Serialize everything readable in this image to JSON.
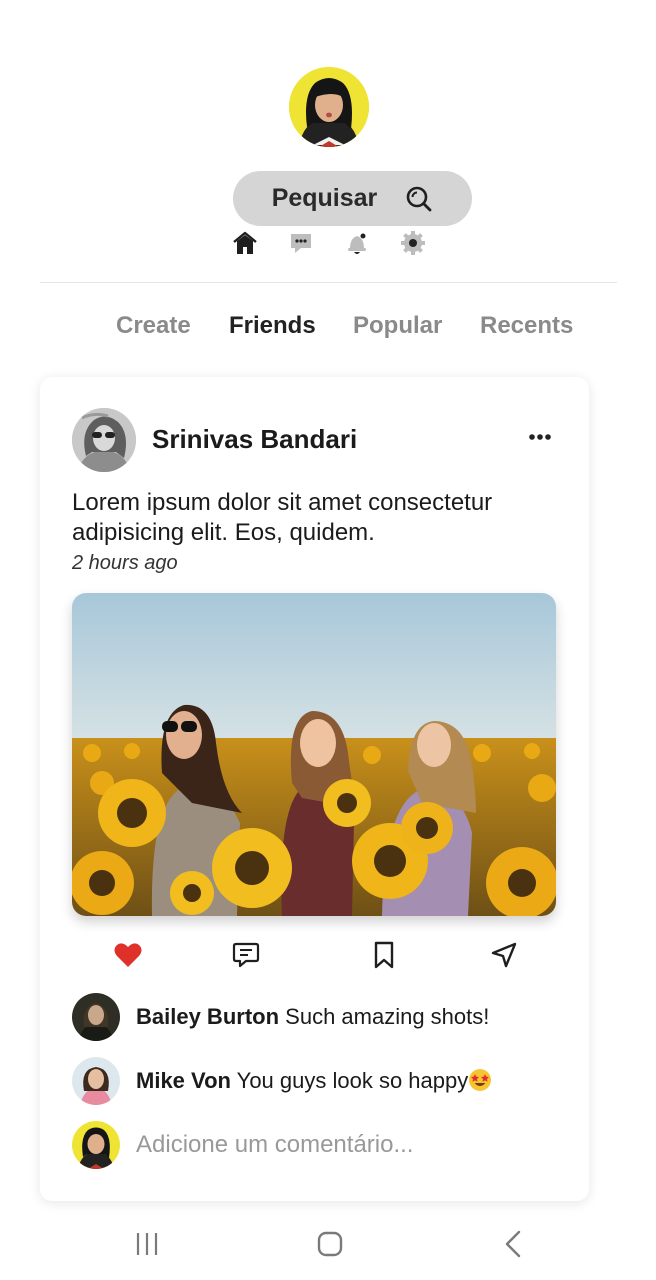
{
  "header": {
    "search_label": "Pequisar",
    "icons": [
      "home-icon",
      "chat-icon",
      "bell-icon",
      "settings-icon"
    ]
  },
  "tabs": [
    {
      "label": "Create",
      "active": false
    },
    {
      "label": "Friends",
      "active": true
    },
    {
      "label": "Popular",
      "active": false
    },
    {
      "label": "Recents",
      "active": false
    }
  ],
  "post": {
    "author": "Srinivas Bandari",
    "text": "Lorem ipsum dolor sit amet consectetur adipisicing elit. Eos, quidem.",
    "time": "2 hours ago",
    "liked": true,
    "actions": [
      "heart-icon",
      "comment-icon",
      "bookmark-icon",
      "share-icon"
    ],
    "comments": [
      {
        "author": "Bailey Burton",
        "text": "Such amazing shots!",
        "emoji": ""
      },
      {
        "author": "Mike Von",
        "text": "You guys look so happy",
        "emoji": "star-struck-emoji"
      }
    ],
    "comment_placeholder": "Adicione um comentário..."
  },
  "colors": {
    "like": "#e0302a",
    "search_pill": "#d5d5d5",
    "tab_active": "#222222",
    "tab_inactive": "#8a8a8a"
  },
  "navbar": [
    "recent-apps-icon",
    "home-nav-icon",
    "back-icon"
  ]
}
